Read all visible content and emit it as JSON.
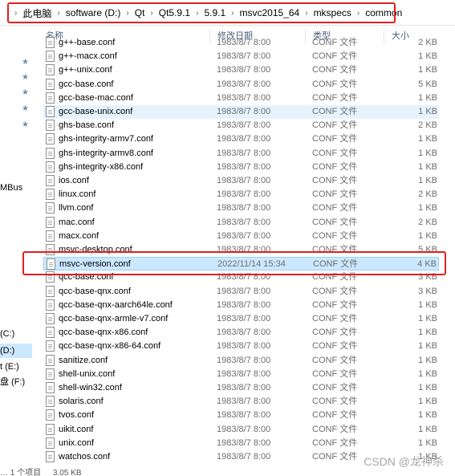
{
  "breadcrumb": [
    "此电脑",
    "software (D:)",
    "Qt",
    "Qt5.9.1",
    "5.9.1",
    "msvc2015_64",
    "mkspecs",
    "common"
  ],
  "columns": {
    "name": "名称",
    "date": "修改日期",
    "type": "类型",
    "size": "大小"
  },
  "nav": {
    "mbus": "MBus",
    "c": "(C:)",
    "d": "(D:)",
    "e": "t (E:)",
    "f": "盘 (F:)"
  },
  "files": [
    {
      "name": "g++-base.conf",
      "date": "1983/8/7 8:00",
      "type": "CONF 文件",
      "size": "2 KB"
    },
    {
      "name": "g++-macx.conf",
      "date": "1983/8/7 8:00",
      "type": "CONF 文件",
      "size": "1 KB"
    },
    {
      "name": "g++-unix.conf",
      "date": "1983/8/7 8:00",
      "type": "CONF 文件",
      "size": "1 KB"
    },
    {
      "name": "gcc-base.conf",
      "date": "1983/8/7 8:00",
      "type": "CONF 文件",
      "size": "5 KB"
    },
    {
      "name": "gcc-base-mac.conf",
      "date": "1983/8/7 8:00",
      "type": "CONF 文件",
      "size": "1 KB"
    },
    {
      "name": "gcc-base-unix.conf",
      "date": "1983/8/7 8:00",
      "type": "CONF 文件",
      "size": "1 KB"
    },
    {
      "name": "ghs-base.conf",
      "date": "1983/8/7 8:00",
      "type": "CONF 文件",
      "size": "2 KB"
    },
    {
      "name": "ghs-integrity-armv7.conf",
      "date": "1983/8/7 8:00",
      "type": "CONF 文件",
      "size": "1 KB"
    },
    {
      "name": "ghs-integrity-armv8.conf",
      "date": "1983/8/7 8:00",
      "type": "CONF 文件",
      "size": "1 KB"
    },
    {
      "name": "ghs-integrity-x86.conf",
      "date": "1983/8/7 8:00",
      "type": "CONF 文件",
      "size": "1 KB"
    },
    {
      "name": "ios.conf",
      "date": "1983/8/7 8:00",
      "type": "CONF 文件",
      "size": "1 KB"
    },
    {
      "name": "linux.conf",
      "date": "1983/8/7 8:00",
      "type": "CONF 文件",
      "size": "2 KB"
    },
    {
      "name": "llvm.conf",
      "date": "1983/8/7 8:00",
      "type": "CONF 文件",
      "size": "1 KB"
    },
    {
      "name": "mac.conf",
      "date": "1983/8/7 8:00",
      "type": "CONF 文件",
      "size": "2 KB"
    },
    {
      "name": "macx.conf",
      "date": "1983/8/7 8:00",
      "type": "CONF 文件",
      "size": "1 KB"
    },
    {
      "name": "msvc-desktop.conf",
      "date": "1983/8/7 8:00",
      "type": "CONF 文件",
      "size": "5 KB"
    },
    {
      "name": "msvc-version.conf",
      "date": "2022/11/14 15:34",
      "type": "CONF 文件",
      "size": "4 KB"
    },
    {
      "name": "qcc-base.conf",
      "date": "1983/8/7 8:00",
      "type": "CONF 文件",
      "size": "3 KB"
    },
    {
      "name": "qcc-base-qnx.conf",
      "date": "1983/8/7 8:00",
      "type": "CONF 文件",
      "size": "3 KB"
    },
    {
      "name": "qcc-base-qnx-aarch64le.conf",
      "date": "1983/8/7 8:00",
      "type": "CONF 文件",
      "size": "1 KB"
    },
    {
      "name": "qcc-base-qnx-armle-v7.conf",
      "date": "1983/8/7 8:00",
      "type": "CONF 文件",
      "size": "1 KB"
    },
    {
      "name": "qcc-base-qnx-x86.conf",
      "date": "1983/8/7 8:00",
      "type": "CONF 文件",
      "size": "1 KB"
    },
    {
      "name": "qcc-base-qnx-x86-64.conf",
      "date": "1983/8/7 8:00",
      "type": "CONF 文件",
      "size": "1 KB"
    },
    {
      "name": "sanitize.conf",
      "date": "1983/8/7 8:00",
      "type": "CONF 文件",
      "size": "1 KB"
    },
    {
      "name": "shell-unix.conf",
      "date": "1983/8/7 8:00",
      "type": "CONF 文件",
      "size": "1 KB"
    },
    {
      "name": "shell-win32.conf",
      "date": "1983/8/7 8:00",
      "type": "CONF 文件",
      "size": "1 KB"
    },
    {
      "name": "solaris.conf",
      "date": "1983/8/7 8:00",
      "type": "CONF 文件",
      "size": "1 KB"
    },
    {
      "name": "tvos.conf",
      "date": "1983/8/7 8:00",
      "type": "CONF 文件",
      "size": "1 KB"
    },
    {
      "name": "uikit.conf",
      "date": "1983/8/7 8:00",
      "type": "CONF 文件",
      "size": "1 KB"
    },
    {
      "name": "unix.conf",
      "date": "1983/8/7 8:00",
      "type": "CONF 文件",
      "size": "1 KB"
    },
    {
      "name": "watchos.conf",
      "date": "1983/8/7 8:00",
      "type": "CONF 文件",
      "size": "1 KB"
    }
  ],
  "status": {
    "count": "… 1 个项目",
    "size": "3.05 KB"
  },
  "watermark": "CSDN @龙神杀",
  "colors": {
    "highlight_red": "#e0201b",
    "selection": "#cce8ff",
    "header_text": "#4c607a"
  }
}
